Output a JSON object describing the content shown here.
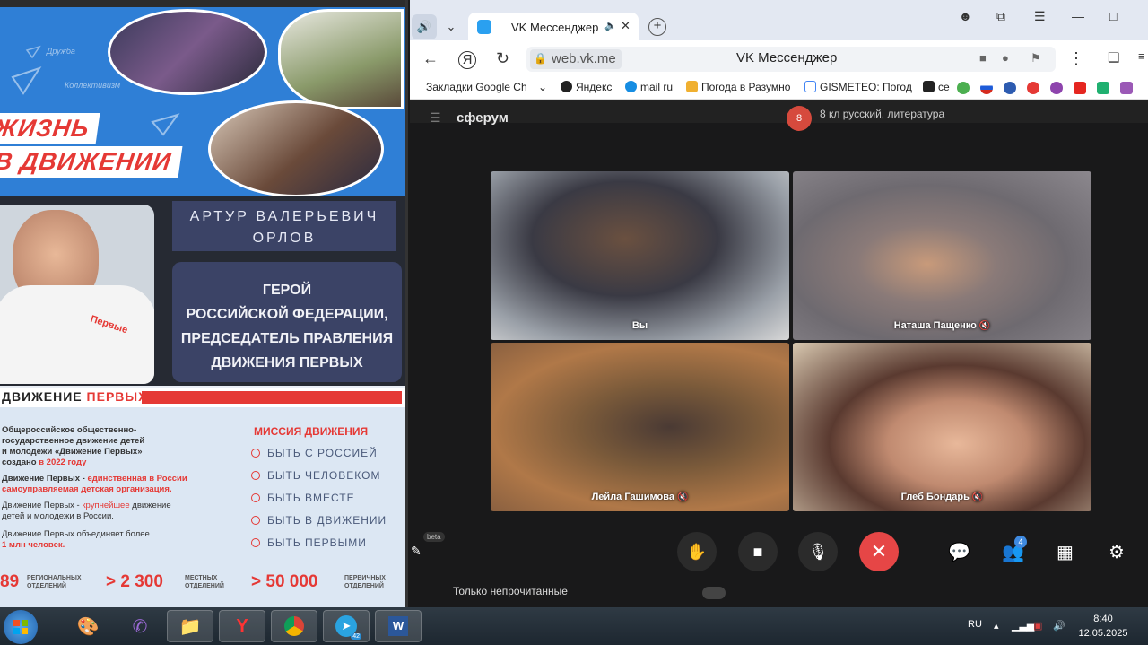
{
  "poster": {
    "watermark_1": "Дружба",
    "watermark_2": "Коллективизм",
    "slogan_line1": "ЖИЗНЬ",
    "slogan_line2": "В ДВИЖЕНИИ",
    "name_line1": "АРТУР ВАЛЕРЬЕВИЧ",
    "name_line2": "ОРЛОВ",
    "title_lines": [
      "ГЕРОЙ",
      "РОССИЙСКОЙ ФЕДЕРАЦИИ,",
      "ПРЕДСЕДАТЕЛЬ ПРАВЛЕНИЯ",
      "ДВИЖЕНИЯ ПЕРВЫХ"
    ],
    "shirt_text": "Первые",
    "movement_prefix": "ДВИЖЕНИЕ ",
    "movement_accent": "ПЕРВЫХ",
    "info": [
      "Общероссийское общественно-",
      "государственное движение детей",
      "и молодежи «Движение Первых»",
      "создано ",
      "в 2022 году",
      "Движение Первых - ",
      "единственная в России",
      "самоуправляемая детская организация.",
      "Движение Первых - ",
      "крупнейшее",
      " движение",
      "детей и молодежи в России.",
      "Движение Первых объединяет более",
      "1 млн человек."
    ],
    "mission_title": "МИССИЯ ДВИЖЕНИЯ",
    "missions": [
      "БЫТЬ С РОССИЕЙ",
      "БЫТЬ ЧЕЛОВЕКОМ",
      "БЫТЬ ВМЕСТЕ",
      "БЫТЬ В ДВИЖЕНИИ",
      "БЫТЬ ПЕРВЫМИ"
    ],
    "stats": [
      {
        "value": "89",
        "label_1": "РЕГИОНАЛЬНЫХ",
        "label_2": "ОТДЕЛЕНИЙ"
      },
      {
        "value": "> 2 300",
        "label_1": "МЕСТНЫХ",
        "label_2": "ОТДЕЛЕНИЙ"
      },
      {
        "value": "> 50 000",
        "label_1": "ПЕРВИЧНЫХ",
        "label_2": "ОТДЕЛЕНИЙ"
      }
    ]
  },
  "browser": {
    "tab_title": "VK Мессенджер",
    "new_tab": "+",
    "url": "web.vk.me",
    "page_title": "VK Мессенджер",
    "bookmarks": [
      "Закладки Google Ch",
      "Яндекс",
      "mail ru",
      "Погода в Разумно",
      "GISMETEO: Погод",
      "ce"
    ]
  },
  "vk": {
    "logo": "сферум",
    "chat_avatar": "8",
    "chat_title": "8 кл русский, литература",
    "unread_label": "Только непрочитанные",
    "beta": "beta"
  },
  "call": {
    "participants": [
      {
        "name": "Вы",
        "muted": false
      },
      {
        "name": "Наташа Пащенко",
        "muted": true
      },
      {
        "name": "Лейла Гашимова",
        "muted": true
      },
      {
        "name": "Глеб Бондарь",
        "muted": true
      }
    ],
    "participants_count": "4"
  },
  "taskbar": {
    "telegram_count": "42",
    "language": "RU",
    "time": "8:40",
    "date": "12.05.2025"
  },
  "colors": {
    "accent_red": "#e53935",
    "vk_end_call": "#e64646",
    "vk_badge": "#3f8ae0"
  }
}
